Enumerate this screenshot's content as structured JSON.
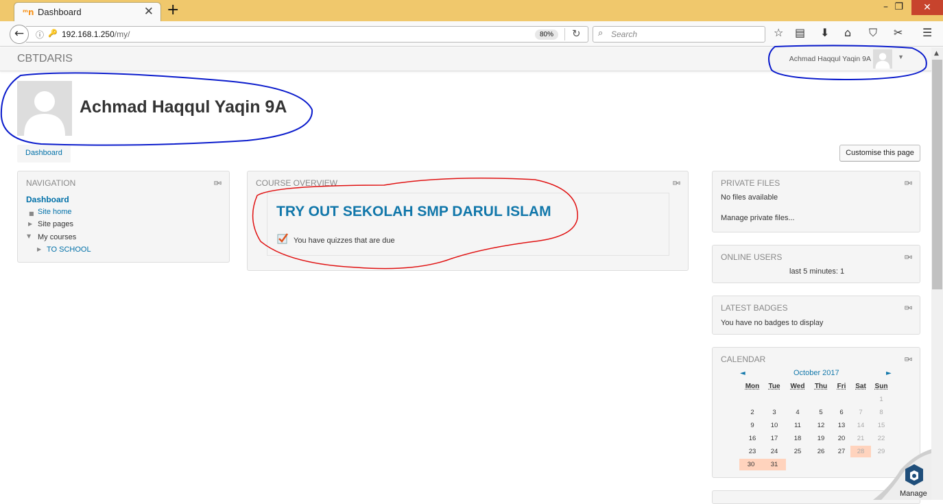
{
  "browser": {
    "tab_title": "Dashboard",
    "tab_favicon": "ᵐn",
    "url_host": "192.168.1.250",
    "url_path": "/my/",
    "zoom": "80%",
    "search_placeholder": "Search",
    "icons": [
      "back-arrow-icon",
      "info-icon",
      "key-icon",
      "reload-icon",
      "search-icon",
      "bookmark-star-icon",
      "reading-list-icon",
      "download-icon",
      "home-icon",
      "pocket-icon",
      "extension-icon",
      "menu-icon"
    ]
  },
  "moodle": {
    "brand": "CBTDARIS",
    "user_name": "Achmad Haqqul Yaqin 9A",
    "page_title": "Achmad Haqqul Yaqin 9A",
    "breadcrumb": "Dashboard",
    "customise_button": "Customise this page",
    "manage_label": "Manage"
  },
  "navigation_block": {
    "title": "NAVIGATION",
    "dashboard": "Dashboard",
    "site_home": "Site home",
    "site_pages": "Site pages",
    "my_courses": "My courses",
    "to_school": "TO SCHOOL"
  },
  "course_overview": {
    "title": "COURSE OVERVIEW",
    "course_name": "TRY OUT SEKOLAH SMP DARUL ISLAM",
    "quiz_notice": "You have quizzes that are due"
  },
  "private_files": {
    "title": "PRIVATE FILES",
    "status": "No files available",
    "manage_link": "Manage private files..."
  },
  "online_users": {
    "title": "ONLINE USERS",
    "status": "last 5 minutes: 1"
  },
  "latest_badges": {
    "title": "LATEST BADGES",
    "status": "You have no badges to display"
  },
  "calendar": {
    "title": "CALENDAR",
    "month": "October 2017",
    "prev": "◄",
    "next": "►",
    "weekdays": [
      "Mon",
      "Tue",
      "Wed",
      "Thu",
      "Fri",
      "Sat",
      "Sun"
    ],
    "weeks": [
      [
        "",
        "",
        "",
        "",
        "",
        "",
        "1"
      ],
      [
        "2",
        "3",
        "4",
        "5",
        "6",
        "7",
        "8"
      ],
      [
        "9",
        "10",
        "11",
        "12",
        "13",
        "14",
        "15"
      ],
      [
        "16",
        "17",
        "18",
        "19",
        "20",
        "21",
        "22"
      ],
      [
        "23",
        "24",
        "25",
        "26",
        "27",
        "28",
        "29"
      ],
      [
        "30",
        "31",
        "",
        "",
        "",
        "",
        ""
      ]
    ],
    "event_days": [
      "28",
      "30",
      "31"
    ],
    "event_color": "#ffd3bd"
  },
  "colors": {
    "tabbar": "#f0c86c",
    "link": "#0070a8",
    "course_title": "#1177aa",
    "annotation_blue": "#0a1bcc",
    "annotation_red": "#e01010"
  }
}
